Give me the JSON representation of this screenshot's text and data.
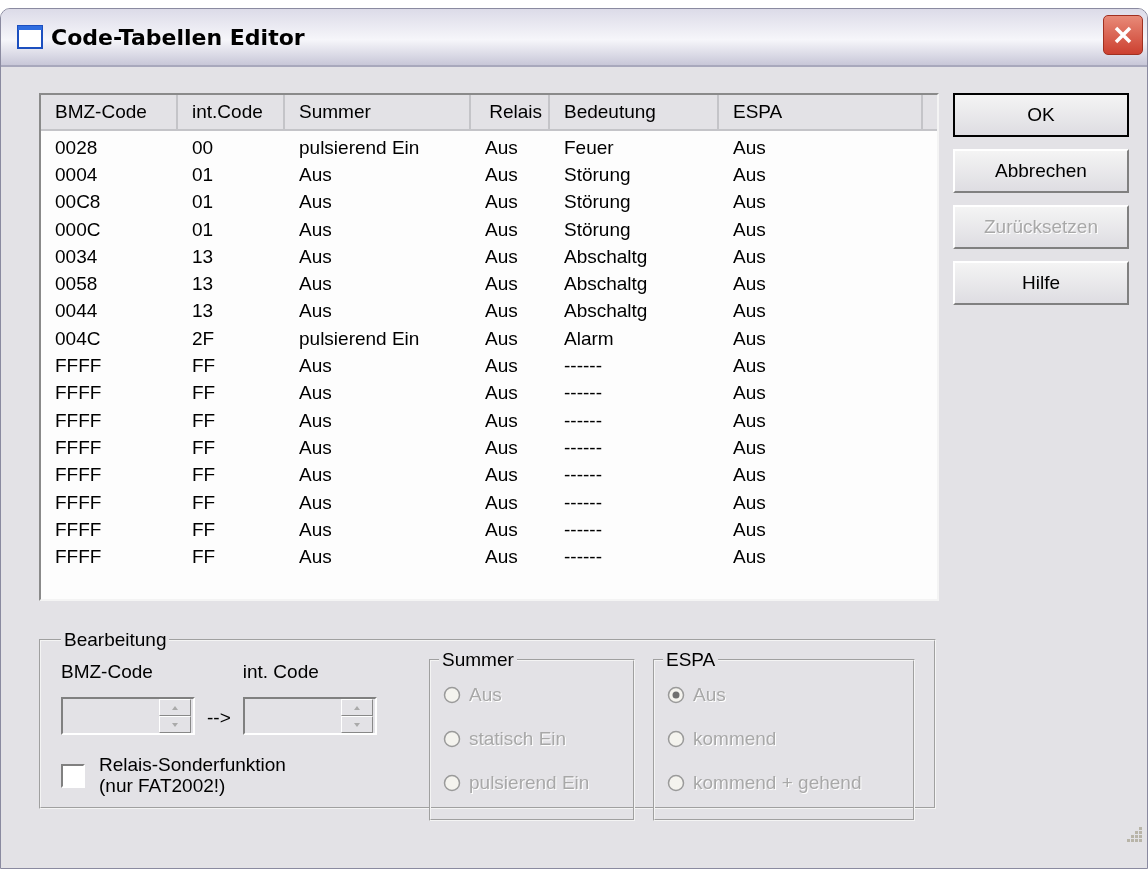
{
  "window": {
    "title": "Code-Tabellen Editor"
  },
  "table": {
    "columns": [
      "BMZ-Code",
      "int.Code",
      "Summer",
      "Relais",
      "Bedeutung",
      "ESPA"
    ],
    "rows": [
      [
        "0028",
        "00",
        "pulsierend Ein",
        "Aus",
        "Feuer",
        "Aus"
      ],
      [
        "0004",
        "01",
        "Aus",
        "Aus",
        "Störung",
        "Aus"
      ],
      [
        "00C8",
        "01",
        "Aus",
        "Aus",
        "Störung",
        "Aus"
      ],
      [
        "000C",
        "01",
        "Aus",
        "Aus",
        "Störung",
        "Aus"
      ],
      [
        "0034",
        "13",
        "Aus",
        "Aus",
        "Abschaltg",
        "Aus"
      ],
      [
        "0058",
        "13",
        "Aus",
        "Aus",
        "Abschaltg",
        "Aus"
      ],
      [
        "0044",
        "13",
        "Aus",
        "Aus",
        "Abschaltg",
        "Aus"
      ],
      [
        "004C",
        "2F",
        "pulsierend Ein",
        "Aus",
        "Alarm",
        "Aus"
      ],
      [
        "FFFF",
        "FF",
        "Aus",
        "Aus",
        "------",
        "Aus"
      ],
      [
        "FFFF",
        "FF",
        "Aus",
        "Aus",
        "------",
        "Aus"
      ],
      [
        "FFFF",
        "FF",
        "Aus",
        "Aus",
        "------",
        "Aus"
      ],
      [
        "FFFF",
        "FF",
        "Aus",
        "Aus",
        "------",
        "Aus"
      ],
      [
        "FFFF",
        "FF",
        "Aus",
        "Aus",
        "------",
        "Aus"
      ],
      [
        "FFFF",
        "FF",
        "Aus",
        "Aus",
        "------",
        "Aus"
      ],
      [
        "FFFF",
        "FF",
        "Aus",
        "Aus",
        "------",
        "Aus"
      ],
      [
        "FFFF",
        "FF",
        "Aus",
        "Aus",
        "------",
        "Aus"
      ]
    ]
  },
  "buttons": [
    {
      "label": "OK",
      "disabled": false,
      "default": true
    },
    {
      "label": "Abbrechen",
      "disabled": false,
      "default": false
    },
    {
      "label": "Zurücksetzen",
      "disabled": true,
      "default": false
    },
    {
      "label": "Hilfe",
      "disabled": false,
      "default": false
    }
  ],
  "editing": {
    "title": "Bearbeitung",
    "bmz_label": "BMZ-Code",
    "arrow": "-->",
    "int_label": "int. Code",
    "spinners_disabled": true,
    "checkbox": {
      "label_lines": [
        "Relais-Sonderfunktion",
        "(nur FAT2002!)"
      ],
      "checked": false
    },
    "groups": [
      {
        "title": "Summer",
        "options": [
          {
            "label": "Aus",
            "selected": false,
            "disabled": true
          },
          {
            "label": "statisch Ein",
            "selected": false,
            "disabled": true
          },
          {
            "label": "pulsierend Ein",
            "selected": false,
            "disabled": true
          }
        ]
      },
      {
        "title": "ESPA",
        "options": [
          {
            "label": "Aus",
            "selected": true,
            "disabled": true
          },
          {
            "label": "kommend",
            "selected": false,
            "disabled": true
          },
          {
            "label": "kommend + gehend",
            "selected": false,
            "disabled": true
          }
        ]
      }
    ]
  }
}
